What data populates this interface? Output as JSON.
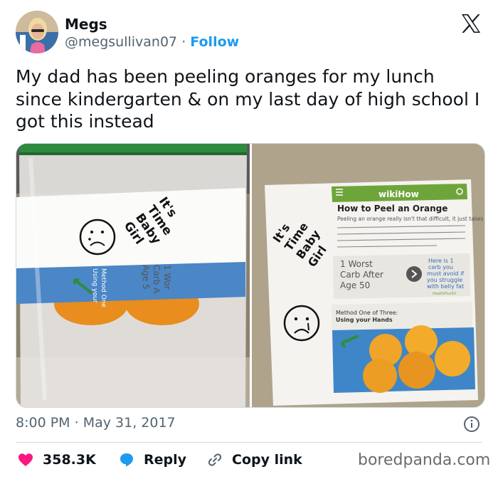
{
  "user": {
    "name": "Megs",
    "handle": "@megsullivan07",
    "separator": "·",
    "follow_label": "Follow"
  },
  "tweet": {
    "text": "My dad has been peeling oranges for my lunch since kindergarten & on my last day of high school I got this instead"
  },
  "photos": {
    "left": {
      "note_line1": "It's",
      "note_line2": "Time",
      "note_line3": "Baby",
      "note_line4": "Girl",
      "strip_a": "Method One",
      "strip_b": "Using your",
      "strip_c": "1 Wor",
      "strip_d": "Carb A",
      "strip_e": "Age 5"
    },
    "right": {
      "header_brand": "wikiHow",
      "title": "How to Peel an Orange",
      "body": "Peeling an orange really isn't that difficult, it just takes a little instruction and practice. In fact, by the time you finish reading this article, you will be well-versed in several of the most popular orange peeling methods!",
      "ad_line1": "1 Worst",
      "ad_line2": "Carb After",
      "ad_line3": "Age 50",
      "ad_link1": "Here is 1",
      "ad_link2": "carb you",
      "ad_link3": "must avoid if",
      "ad_link4": "you struggle",
      "ad_link5": "with belly fat",
      "ad_source": "HealthPlus50",
      "method_title": "Method One of Three:",
      "method_sub": "Using your Hands",
      "note_line1": "It's",
      "note_line2": "Time",
      "note_line3": "Baby",
      "note_line4": "Girl"
    }
  },
  "meta": {
    "time": "8:00 PM",
    "separator": "·",
    "date": "May 31, 2017"
  },
  "actions": {
    "likes": "358.3K",
    "reply_label": "Reply",
    "copy_label": "Copy link"
  },
  "watermark": "boredpanda.com",
  "colors": {
    "accent": "#1d9bf0",
    "like": "#f91880",
    "text": "#0f1419",
    "muted": "#536471",
    "wikihow_green": "#6ea53b"
  },
  "icons": [
    "x-logo-icon",
    "info-icon",
    "heart-icon",
    "reply-bubble-icon",
    "link-icon"
  ]
}
